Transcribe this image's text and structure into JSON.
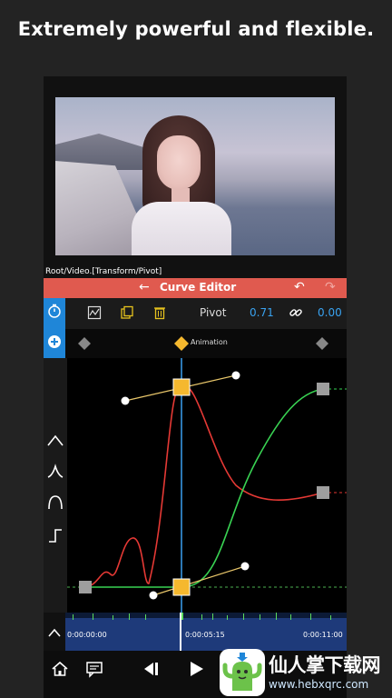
{
  "headline": "Extremely powerful and flexible.",
  "path_label": "Root/Video.[Transform/Pivot]",
  "curve_editor": {
    "title": "Curve Editor",
    "pivot_label": "Pivot",
    "pivot_x": "0.71",
    "pivot_y": "0.00",
    "keyframe_label": "Animation"
  },
  "timeline": {
    "time_start": "0:00:00:00",
    "time_current": "0:00:05:15",
    "time_end": "0:00:11:00"
  },
  "watermark": {
    "title": "仙人掌下载网",
    "url": "www.hebxqrc.com"
  },
  "colors": {
    "title_bar": "#e05a4f",
    "accent_blue": "#1f86d8",
    "value_blue": "#39a2f0",
    "curve_red": "#e53935",
    "curve_green": "#39d353",
    "keyframe_yellow": "#f5b82e"
  }
}
